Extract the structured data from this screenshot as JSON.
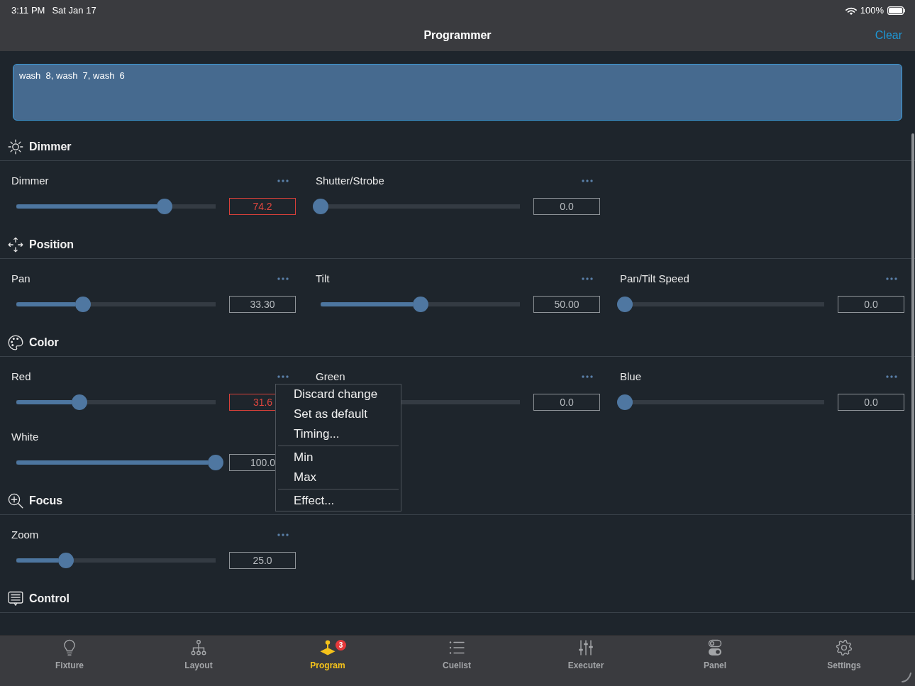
{
  "status_bar": {
    "time": "3:11 PM",
    "date": "Sat Jan 17",
    "battery": "100%"
  },
  "nav_bar": {
    "title": "Programmer",
    "action": "Clear"
  },
  "selection": {
    "value": "wash  8, wash  7, wash  6"
  },
  "sections": [
    {
      "kind": "dimmer",
      "title": "Dimmer",
      "params": [
        {
          "label": "Dimmer",
          "value": "74.2",
          "level": 0.742,
          "modified": true
        },
        {
          "label": "Shutter/Strobe",
          "value": "0.0",
          "level": 0,
          "modified": false
        }
      ]
    },
    {
      "kind": "position",
      "title": "Position",
      "params": [
        {
          "label": "Pan",
          "value": "33.30",
          "level": 0.333,
          "modified": false
        },
        {
          "label": "Tilt",
          "value": "50.00",
          "level": 0.5,
          "modified": false
        },
        {
          "label": "Pan/Tilt Speed",
          "value": "0.0",
          "level": 0,
          "modified": false
        }
      ]
    },
    {
      "kind": "color",
      "title": "Color",
      "params": [
        {
          "label": "Red",
          "value": "31.6",
          "level": 0.316,
          "modified": true
        },
        {
          "label": "Green",
          "value": "0.0",
          "modified": false
        },
        {
          "label": "Blue",
          "value": "0.0",
          "level": 0,
          "modified": false
        },
        {
          "label": "White",
          "value": "100.0",
          "level": 1,
          "modified": false
        }
      ]
    },
    {
      "kind": "focus",
      "title": "Focus",
      "params": [
        {
          "label": "Zoom",
          "value": "25.0",
          "level": 0.25,
          "modified": false
        }
      ]
    },
    {
      "kind": "control",
      "title": "Control"
    }
  ],
  "context_menu": {
    "groups": [
      [
        "Discard change",
        "Set as default",
        "Timing..."
      ],
      [
        "Min",
        "Max"
      ],
      [
        "Effect..."
      ]
    ]
  },
  "tab_bar": [
    {
      "kind": "fixture",
      "label": "Fixture",
      "selected": false
    },
    {
      "kind": "layout",
      "label": "Layout",
      "selected": false
    },
    {
      "kind": "program",
      "label": "Program",
      "selected": true,
      "badge": "3"
    },
    {
      "kind": "cuelist",
      "label": "Cuelist",
      "selected": false
    },
    {
      "kind": "executer",
      "label": "Executer",
      "selected": false
    },
    {
      "kind": "panel",
      "label": "Panel",
      "selected": false
    },
    {
      "kind": "settings",
      "label": "Settings",
      "selected": false
    }
  ]
}
